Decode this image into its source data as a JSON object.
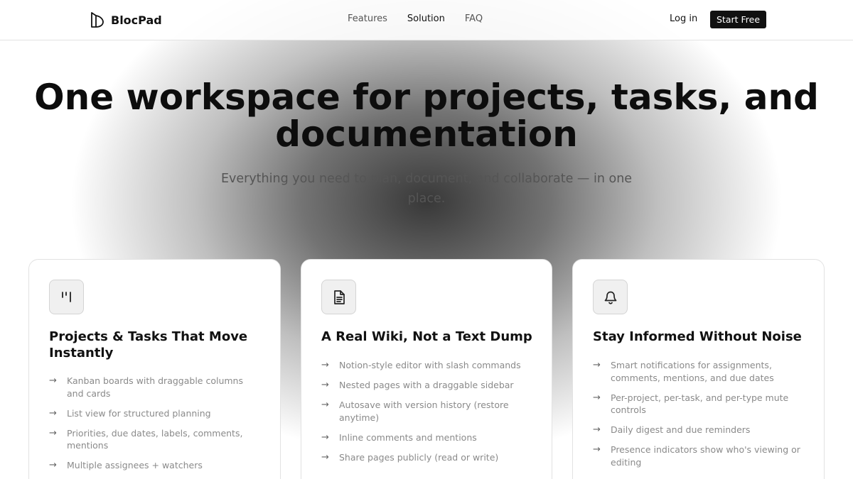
{
  "brand": {
    "name": "BlocPad"
  },
  "nav": [
    {
      "label": "Features"
    },
    {
      "label": "Solution"
    },
    {
      "label": "FAQ"
    }
  ],
  "auth": {
    "login": "Log in",
    "start": "Start Free"
  },
  "hero": {
    "title": "One workspace for projects, tasks, and documentation",
    "subtitle": "Everything you need to plan, document, and collaborate — in one place."
  },
  "cards": [
    {
      "icon": "kanban-icon",
      "title": "Projects & Tasks That Move Instantly",
      "items": [
        "Kanban boards with draggable columns and cards",
        "List view for structured planning",
        "Priorities, due dates, labels, comments, mentions",
        "Multiple assignees + watchers"
      ]
    },
    {
      "icon": "document-icon",
      "title": "A Real Wiki, Not a Text Dump",
      "items": [
        "Notion-style editor with slash commands",
        "Nested pages with a draggable sidebar",
        "Autosave with version history (restore anytime)",
        "Inline comments and mentions",
        "Share pages publicly (read or write)"
      ]
    },
    {
      "icon": "bell-icon",
      "title": "Stay Informed Without Noise",
      "items": [
        "Smart notifications for assignments, comments, mentions, and due dates",
        "Per-project, per-task, and per-type mute controls",
        "Daily digest and due reminders",
        "Presence indicators show who's viewing or editing"
      ]
    }
  ]
}
